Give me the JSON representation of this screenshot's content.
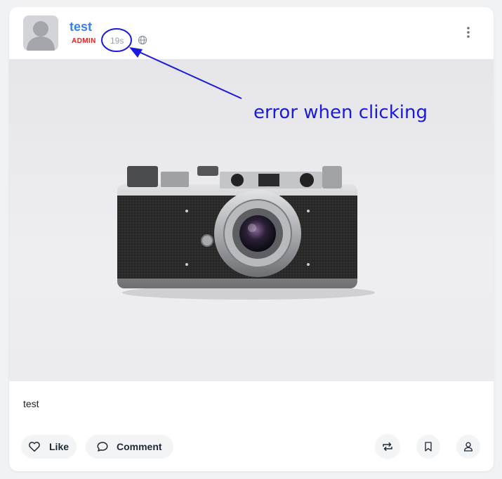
{
  "post": {
    "author": "test",
    "role": "ADMIN",
    "time_ago": "19s",
    "visibility_icon": "globe-icon",
    "menu_icon": "more-vertical-icon",
    "image_subject": "vintage-camera",
    "body_text": "test"
  },
  "actions": {
    "like_label": "Like",
    "comment_label": "Comment",
    "repost_icon": "repost-icon",
    "bookmark_icon": "bookmark-icon",
    "profile_icon": "user-icon"
  },
  "annotation": {
    "text": "error when clicking",
    "color": "#1a1adb"
  },
  "colors": {
    "author": "#3b82e6",
    "role": "#dc2626",
    "timestamp": "#9aa0a8"
  }
}
